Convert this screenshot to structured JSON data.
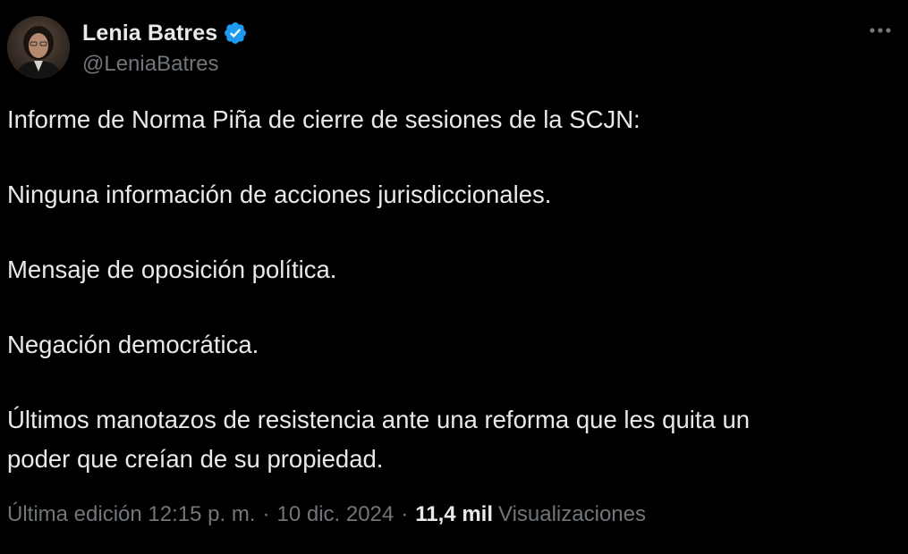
{
  "author": {
    "display_name": "Lenia Batres",
    "handle": "@LeniaBatres",
    "verified": true,
    "avatar_icon": "profile-photo"
  },
  "tweet": {
    "paragraphs": [
      "Informe de Norma Piña de cierre de sesiones de la SCJN:",
      "Ninguna información de acciones jurisdiccionales.",
      "Mensaje de oposición política.",
      "Negación democrática."
    ],
    "last_paragraph_lines": [
      "Últimos manotazos de resistencia ante una reforma que les quita un",
      "poder que creían de su propiedad."
    ]
  },
  "meta": {
    "edited_label": "Última edición",
    "time": "12:15 p. m.",
    "separator": "·",
    "date": "10 dic. 2024",
    "views_count": "11,4 mil",
    "views_label": "Visualizaciones"
  },
  "colors": {
    "background": "#000000",
    "text_primary": "#e7e9ea",
    "text_secondary": "#71767b",
    "verified_badge": "#1d9bf0"
  },
  "icons": {
    "more": "more-horizontal-icon",
    "verified": "verified-badge-icon"
  }
}
